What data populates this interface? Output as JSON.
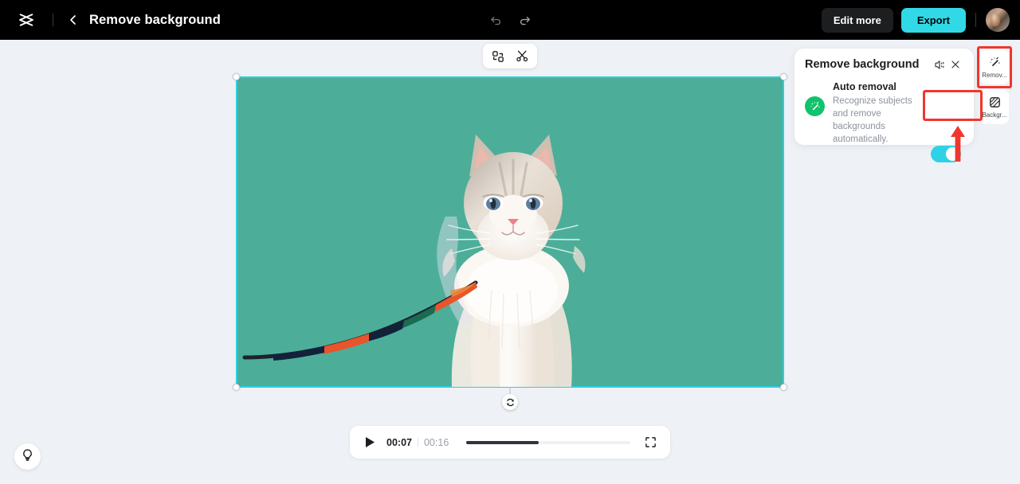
{
  "header": {
    "logo_icon": "capcut-logo-icon",
    "back_icon": "chevron-left-icon",
    "project_title": "Remove background",
    "undo_icon": "undo-icon",
    "redo_icon": "redo-icon",
    "edit_more_label": "Edit more",
    "export_label": "Export",
    "avatar_label": "user-avatar"
  },
  "float_toolbar": {
    "replace_icon": "replace-clip-icon",
    "split_icon": "scissors-split-icon"
  },
  "canvas": {
    "background_color": "#4cae99",
    "selection_color": "#2ccfe0",
    "rotate_icon": "rotate-icon",
    "subject": "cat"
  },
  "player": {
    "play_icon": "play-icon",
    "current_time": "00:07",
    "total_time": "00:16",
    "progress_percent": 44,
    "fullscreen_icon": "fullscreen-icon",
    "fill_color": "#31343c"
  },
  "help": {
    "icon": "lightbulb-icon"
  },
  "panel": {
    "title": "Remove background",
    "speaker_icon": "speaker-icon",
    "close_icon": "close-icon",
    "magic_icon": "magic-wand-icon",
    "option_title": "Auto removal",
    "option_desc": "Recognize subjects and remove backgrounds automatically.",
    "toggle_on": true,
    "toggle_color": "#2ed2e6"
  },
  "rail": {
    "items": [
      {
        "label": "Remov...",
        "icon": "magic-wand-icon"
      },
      {
        "label": "Backgr...",
        "icon": "hatched-square-icon"
      }
    ]
  },
  "annotations": {
    "highlight_color": "#f0372e",
    "arrow_icon": "up-arrow-annotation"
  }
}
